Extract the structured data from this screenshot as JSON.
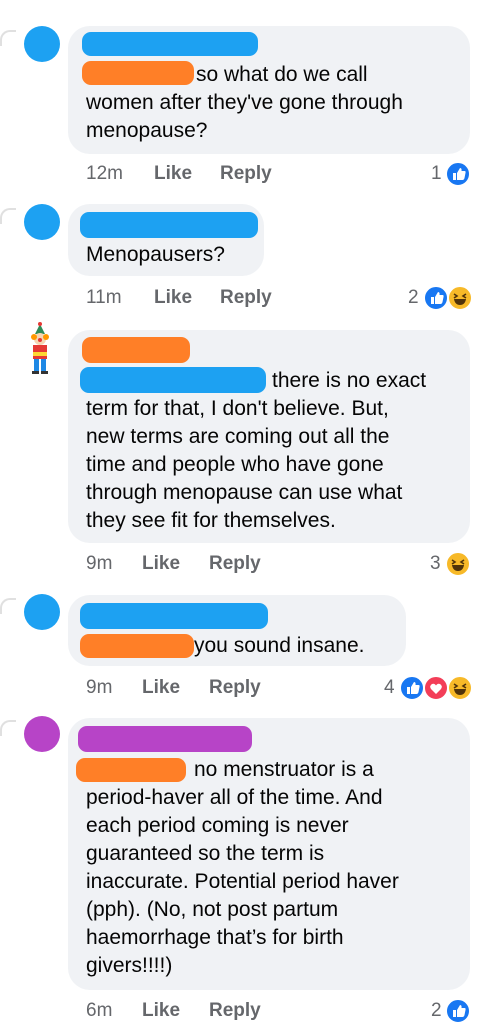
{
  "colors": {
    "like": "#1877f2",
    "love": "#f33e58",
    "haha": "#f7b928",
    "redact_blue": "#1da1f2",
    "redact_orange": "#ff7f27",
    "redact_purple": "#b744c7"
  },
  "comments": [
    {
      "text": "so what do we call women after they've gone through menopause?",
      "time": "12m",
      "like_label": "Like",
      "reply_label": "Reply",
      "reaction_count": "1",
      "reactions": [
        "like-icon"
      ]
    },
    {
      "text": "Menopausers?",
      "time": "11m",
      "like_label": "Like",
      "reply_label": "Reply",
      "reaction_count": "2",
      "reactions": [
        "like-icon",
        "haha-icon"
      ]
    },
    {
      "text": "there is no exact term for that, I don't believe. But, new terms are coming out all the time and people who have gone through menopause can use what they see fit for themselves.",
      "time": "9m",
      "like_label": "Like",
      "reply_label": "Reply",
      "reaction_count": "3",
      "reactions": [
        "haha-icon"
      ]
    },
    {
      "text": "you sound insane.",
      "time": "9m",
      "like_label": "Like",
      "reply_label": "Reply",
      "reaction_count": "4",
      "reactions": [
        "like-icon",
        "love-icon",
        "haha-icon"
      ]
    },
    {
      "text": "no menstruator is a period-haver all of the time. And each period coming is never guaranteed so the term is inaccurate. Potential period haver (pph). (No, not post partum haemorrhage that’s for birth givers!!!!)",
      "time": "6m",
      "like_label": "Like",
      "reply_label": "Reply",
      "reaction_count": "2",
      "reactions": [
        "like-icon"
      ]
    }
  ],
  "lines": {
    "c0": [
      "so what do we call",
      "women after they've gone through",
      "menopause?"
    ],
    "c1": [
      "Menopausers?"
    ],
    "c2": [
      "there is no exact",
      "term for that, I don't believe. But,",
      "new terms are coming out all the",
      "time and people who have gone",
      "through menopause can use what",
      "they see fit for themselves."
    ],
    "c3": [
      "you sound insane."
    ],
    "c4": [
      "no menstruator is a",
      "period-haver all of the time. And",
      "each period coming is never",
      "guaranteed so the term is",
      "inaccurate. Potential period haver",
      "(pph). (No, not post partum",
      "haemorrhage that’s for birth",
      "givers!!!!)"
    ]
  }
}
